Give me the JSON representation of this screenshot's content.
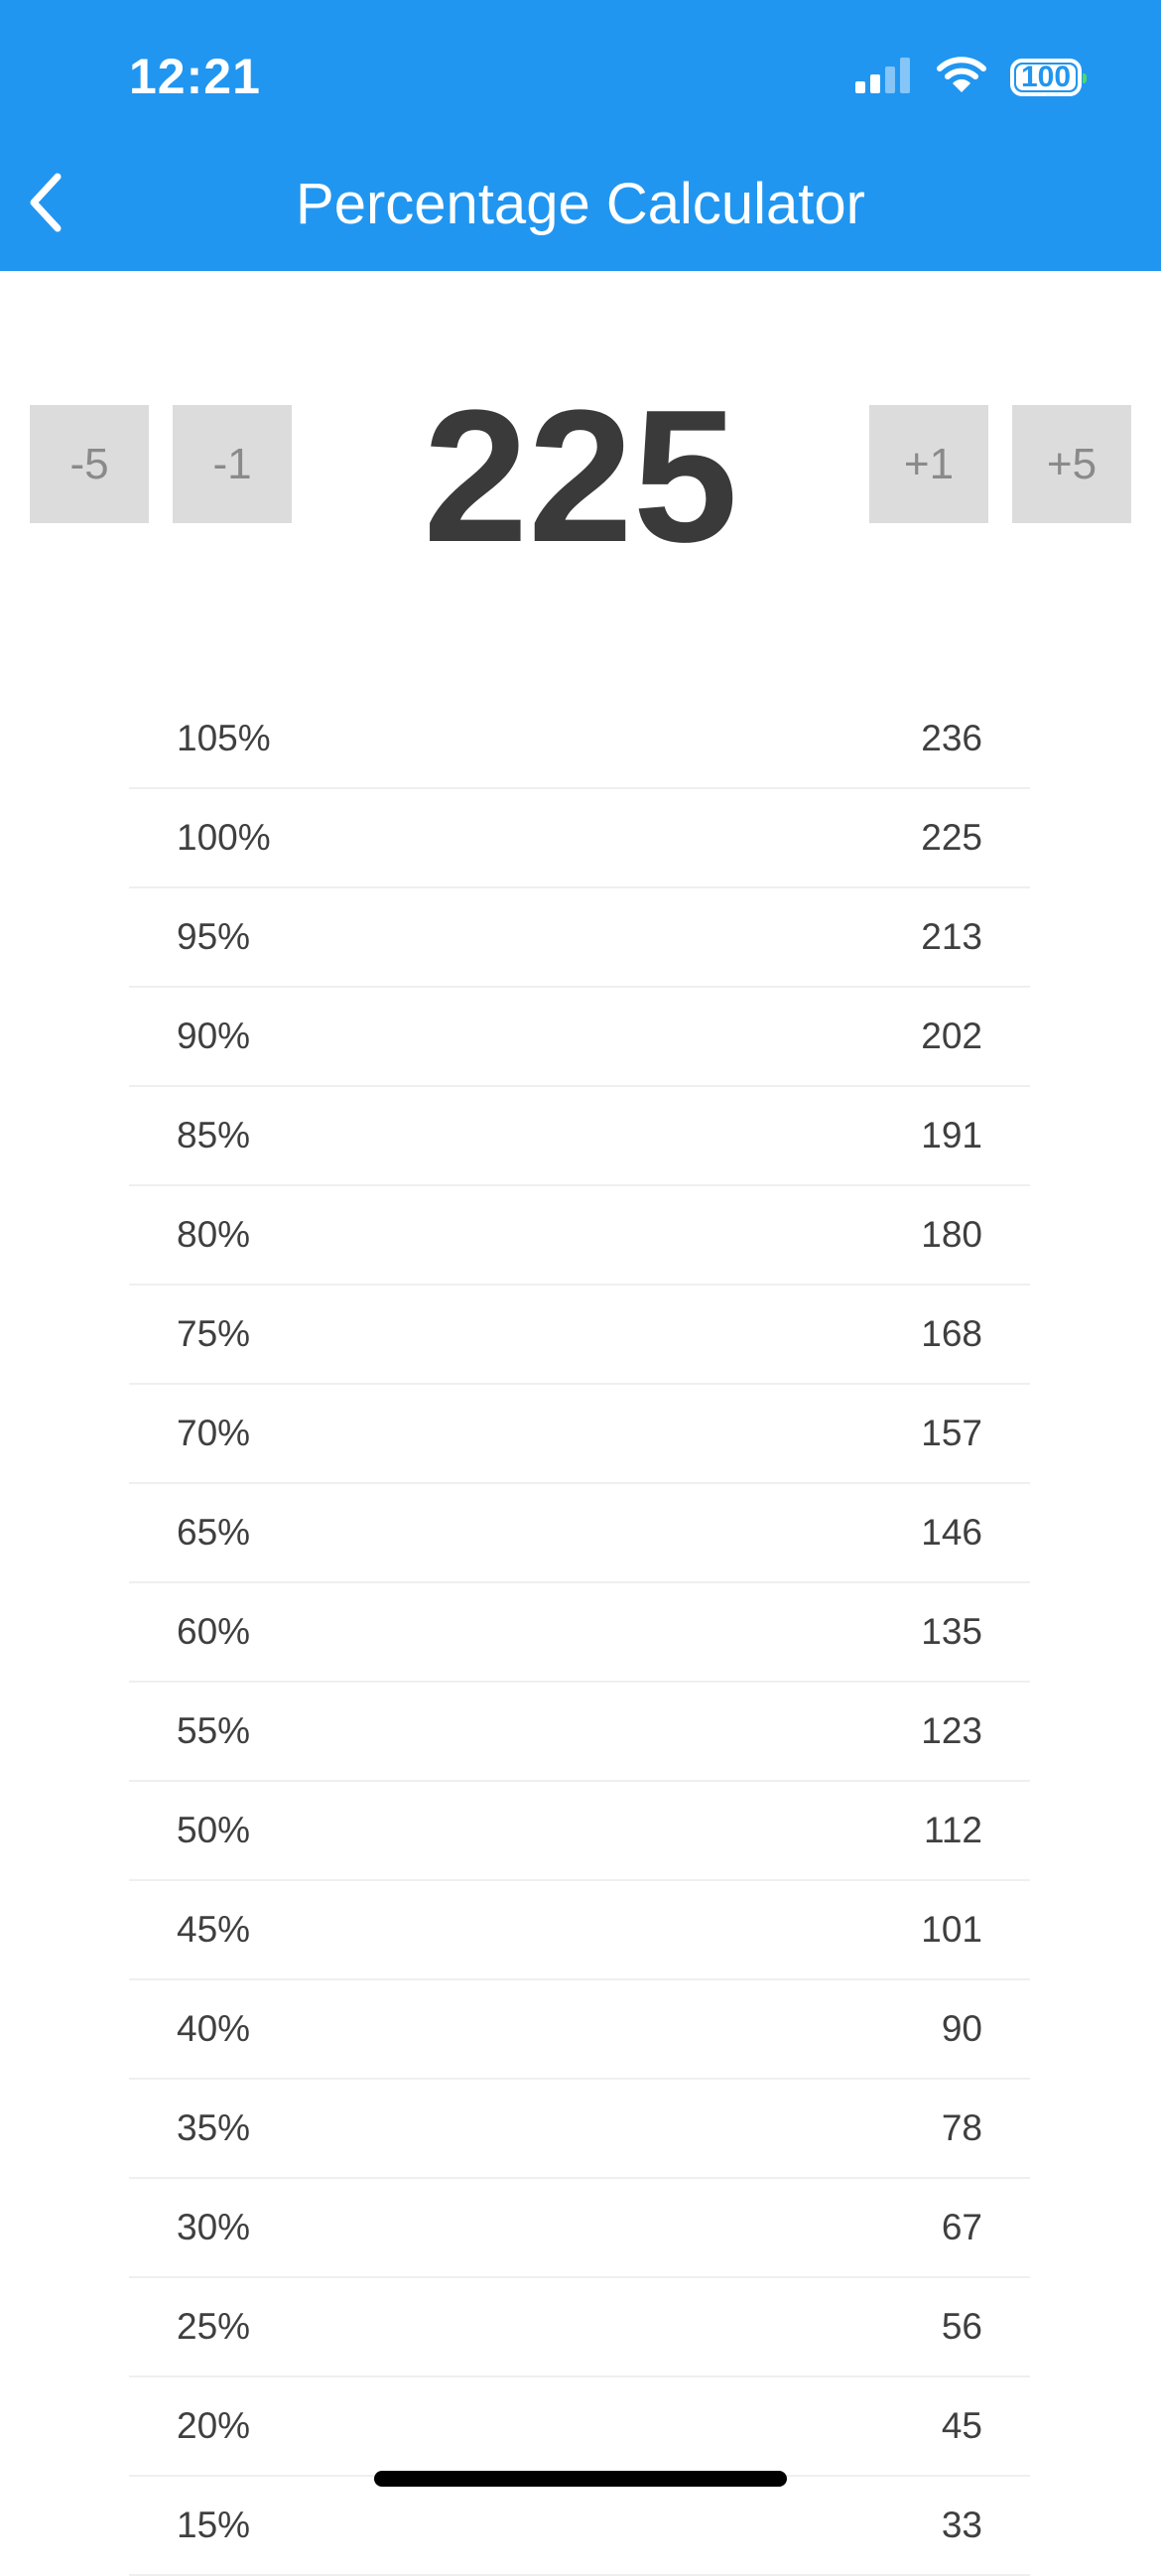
{
  "status_bar": {
    "time": "12:21",
    "battery": "100",
    "icons": [
      "cellular-signal-icon",
      "wifi-icon",
      "battery-icon"
    ]
  },
  "nav": {
    "title": "Percentage Calculator",
    "back_icon": "chevron-left-icon"
  },
  "calculator": {
    "value": "225",
    "minus5": "-5",
    "minus1": "-1",
    "plus1": "+1",
    "plus5": "+5"
  },
  "rows": [
    {
      "percent": "105%",
      "value": "236"
    },
    {
      "percent": "100%",
      "value": "225"
    },
    {
      "percent": "95%",
      "value": "213"
    },
    {
      "percent": "90%",
      "value": "202"
    },
    {
      "percent": "85%",
      "value": "191"
    },
    {
      "percent": "80%",
      "value": "180"
    },
    {
      "percent": "75%",
      "value": "168"
    },
    {
      "percent": "70%",
      "value": "157"
    },
    {
      "percent": "65%",
      "value": "146"
    },
    {
      "percent": "60%",
      "value": "135"
    },
    {
      "percent": "55%",
      "value": "123"
    },
    {
      "percent": "50%",
      "value": "112"
    },
    {
      "percent": "45%",
      "value": "101"
    },
    {
      "percent": "40%",
      "value": "90"
    },
    {
      "percent": "35%",
      "value": "78"
    },
    {
      "percent": "30%",
      "value": "67"
    },
    {
      "percent": "25%",
      "value": "56"
    },
    {
      "percent": "20%",
      "value": "45"
    },
    {
      "percent": "15%",
      "value": "33"
    }
  ],
  "colors": {
    "header": "#2196f0",
    "stepper_bg": "#dcdcdc",
    "stepper_text": "#8a8a8a",
    "text": "#3a3a3a",
    "divider": "#efefef"
  }
}
